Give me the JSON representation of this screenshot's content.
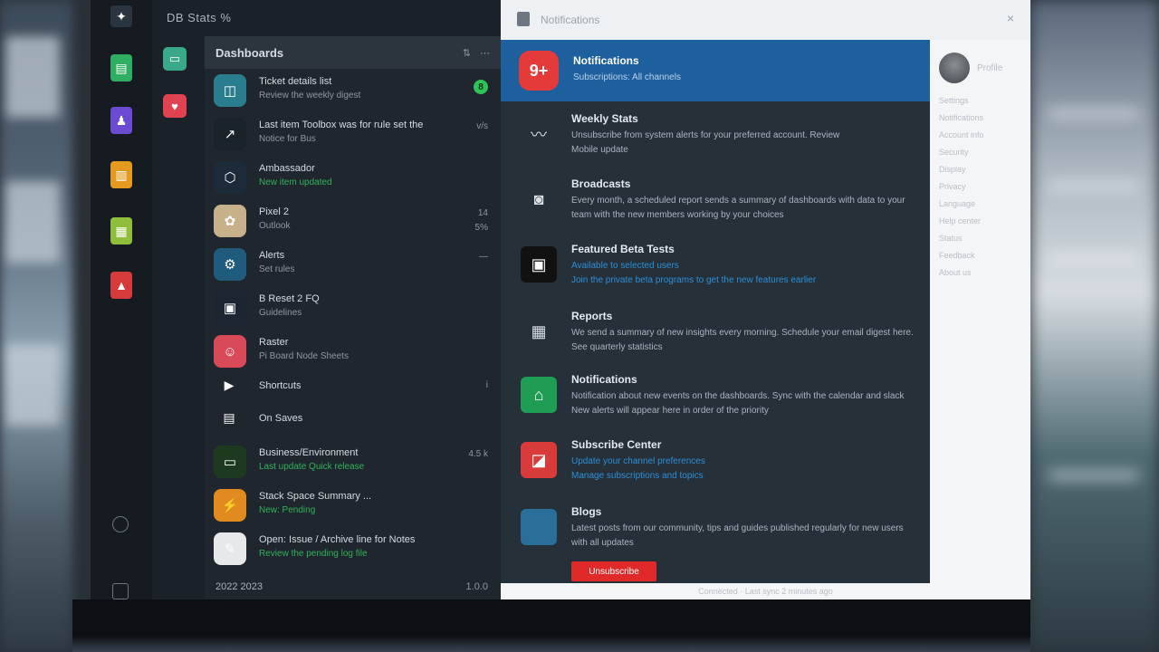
{
  "topbar": {
    "title": "DB Stats %"
  },
  "list": {
    "header": "Dashboards",
    "header_icons": [
      "filter-icon",
      "more-icon"
    ],
    "rows": [
      {
        "title": "Ticket details list",
        "subtitle": "Review the weekly digest",
        "meta": "",
        "badge": "8",
        "color": "#2a7d8f",
        "glyph": "◫"
      },
      {
        "title": "Last item Toolbox was for rule set the",
        "subtitle": "Notice for Bus",
        "meta": "v/s",
        "badge": "",
        "color": "#1a222a",
        "glyph": "↗"
      },
      {
        "title": "Ambassador",
        "subtitle": "New item updated",
        "meta": "",
        "badge": "",
        "color": "#1b2b3a",
        "glyph": "⬡",
        "sub_style": "green"
      },
      {
        "title": "Pixel 2",
        "subtitle": "Outlook",
        "meta": "14",
        "meta2": "5%",
        "badge": "",
        "color": "#c7b08a",
        "glyph": "✿"
      },
      {
        "title": "Alerts",
        "subtitle": "Set rules",
        "meta": "—",
        "badge": "",
        "color": "#1e5b7d",
        "glyph": "⚙"
      },
      {
        "title": "B Reset 2 FQ",
        "subtitle": "Guidelines",
        "meta": "",
        "badge": "",
        "color": "#1b2631",
        "glyph": "▣"
      },
      {
        "title": "Raster",
        "subtitle": "Pi Board Node Sheets",
        "meta": "",
        "badge": "",
        "color": "#d84a57",
        "glyph": "☺"
      },
      {
        "title": "Shortcuts",
        "subtitle": "",
        "meta": "i",
        "badge": "",
        "color": "transparent",
        "glyph": "▶",
        "small": true
      },
      {
        "title": "On Saves",
        "subtitle": "",
        "meta": "",
        "badge": "",
        "color": "transparent",
        "glyph": "▤",
        "small": true
      },
      {
        "title": "Business/Environment",
        "subtitle": "Last update Quick release",
        "meta": "4.5 k",
        "badge": "",
        "color": "#1e3a1e",
        "glyph": "▭",
        "sub_style": "green"
      },
      {
        "title": "Stack Space Summary ...",
        "subtitle": "New: Pending",
        "meta": "",
        "badge": "",
        "color": "#e08a1f",
        "glyph": "⚡",
        "sub_style": "green"
      },
      {
        "title": "Open: Issue / Archive line for Notes",
        "subtitle": "Review the pending log file",
        "meta": "",
        "badge": "",
        "color": "#e6e8ea",
        "glyph": "✎",
        "sub_style": "green"
      }
    ],
    "footer_left": "2022 2023",
    "footer_right": "1.0.0"
  },
  "window": {
    "title": "Notifications",
    "close": "×",
    "head": {
      "glyph": "9+",
      "title": "Notifications",
      "subtitle": "Subscriptions: All channels"
    },
    "items": [
      {
        "title": "Weekly Stats",
        "line1": "Unsubscribe from system alerts for your preferred account. Review",
        "line2": "Mobile update",
        "color": "transparent",
        "glyph": "〰"
      },
      {
        "title": "Broadcasts",
        "line1": "Every month, a scheduled report sends a summary of dashboards with data to your",
        "line2": "team with the new members working by your choices",
        "color": "transparent",
        "glyph": "◙"
      },
      {
        "title": "Featured Beta Tests",
        "line1": "Available to selected users",
        "line2": "Join the private beta programs to get the new features earlier",
        "color": "#111",
        "glyph": "▣",
        "blue": true
      },
      {
        "title": "Reports",
        "line1": "We send a summary of new insights every morning. Schedule your email digest here.",
        "line2": "See quarterly statistics",
        "color": "transparent",
        "glyph": "▦"
      },
      {
        "title": "Notifications",
        "line1": "Notification about new events on the dashboards. Sync with the calendar and slack",
        "line2": "New alerts will appear here in order of the priority",
        "color": "#1f9d55",
        "glyph": "⌂"
      },
      {
        "title": "Subscribe Center",
        "line1": "Update your channel preferences",
        "line2": "Manage subscriptions and topics",
        "color": "#d93b3b",
        "glyph": "◪",
        "blue": true
      },
      {
        "title": "Blogs",
        "line1": "Latest posts from our community, tips and guides published regularly for new users",
        "line2": "with all updates",
        "color": "#2a6f9a",
        "glyph": ""
      }
    ],
    "button": "Unsubscribe",
    "side": {
      "name": "Profile",
      "lines": [
        "Settings",
        "Notifications",
        "Account info",
        "Security",
        "Display",
        "Privacy",
        "Language",
        "Help center",
        "Status",
        "Feedback",
        "About us"
      ]
    },
    "status": "Connected · Last sync 2 minutes ago"
  },
  "rail": {
    "items": [
      {
        "name": "tasks-icon",
        "color": "#2fae63",
        "glyph": "▤"
      },
      {
        "name": "user-icon",
        "color": "#6b4bd1",
        "glyph": "♟"
      },
      {
        "name": "chart-icon",
        "color": "#e39a1f",
        "glyph": "▥"
      },
      {
        "name": "calendar-icon",
        "color": "#8fbf3a",
        "glyph": "▦"
      },
      {
        "name": "alert-icon",
        "color": "#d63a3a",
        "glyph": "▲"
      }
    ],
    "second": [
      {
        "name": "document-icon",
        "color": "#3aa98a",
        "glyph": "▭"
      },
      {
        "name": "heart-icon",
        "color": "#e0424f",
        "glyph": "♥"
      }
    ]
  }
}
